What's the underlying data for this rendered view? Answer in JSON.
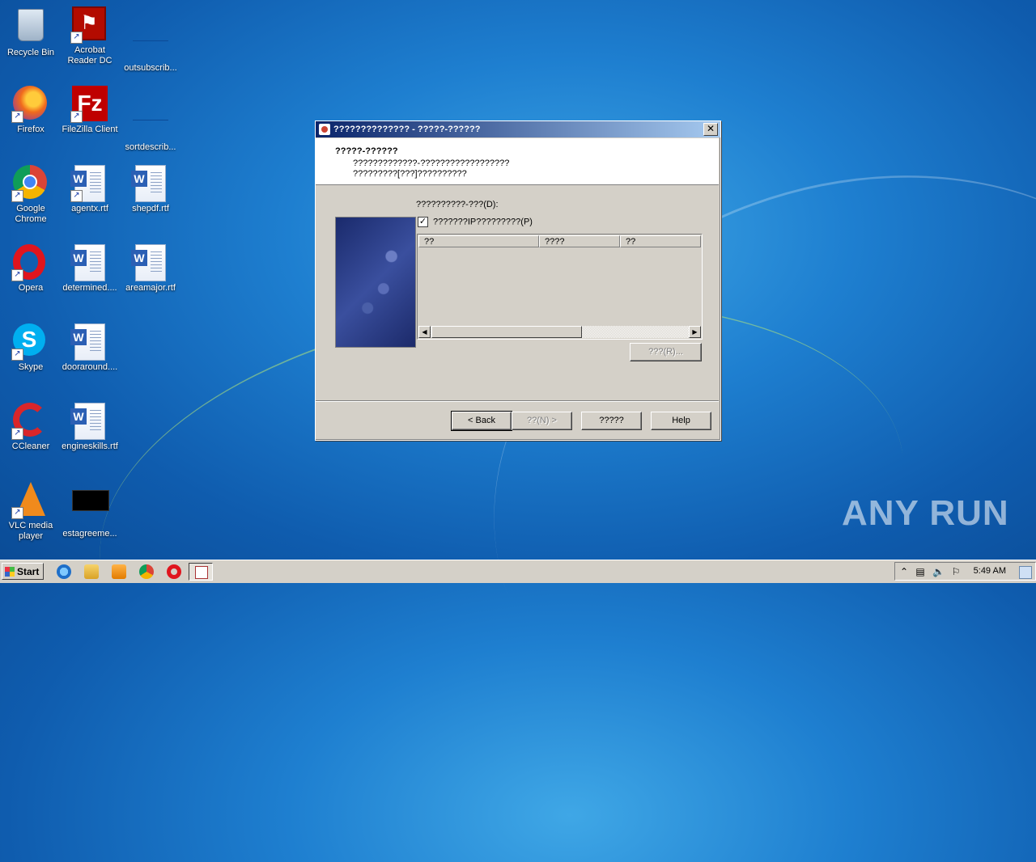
{
  "desktop": {
    "icons": [
      {
        "label": "Recycle Bin",
        "icon": "recycle-bin-icon"
      },
      {
        "label": "Acrobat Reader DC",
        "icon": "acrobat-icon"
      },
      {
        "label": "outsubscrib...",
        "icon": "file-icon"
      },
      {
        "label": "Firefox",
        "icon": "firefox-icon"
      },
      {
        "label": "FileZilla Client",
        "icon": "filezilla-icon"
      },
      {
        "label": "sortdescrib...",
        "icon": "file-icon"
      },
      {
        "label": "Google Chrome",
        "icon": "chrome-icon"
      },
      {
        "label": "agentx.rtf",
        "icon": "word-doc-icon"
      },
      {
        "label": "shepdf.rtf",
        "icon": "word-doc-icon"
      },
      {
        "label": "Opera",
        "icon": "opera-icon"
      },
      {
        "label": "determined....",
        "icon": "word-doc-icon"
      },
      {
        "label": "areamajor.rtf",
        "icon": "word-doc-icon"
      },
      {
        "label": "Skype",
        "icon": "skype-icon"
      },
      {
        "label": "dooraround....",
        "icon": "word-doc-icon"
      },
      {
        "label": "CCleaner",
        "icon": "ccleaner-icon"
      },
      {
        "label": "engineskills.rtf",
        "icon": "word-doc-icon"
      },
      {
        "label": "VLC media player",
        "icon": "vlc-icon"
      },
      {
        "label": "estagreeme...",
        "icon": "file-icon"
      }
    ]
  },
  "dialog": {
    "title": "?????????????? - ?????-??????",
    "header_title": "?????-??????",
    "header_line1": "?????????????-??????????????????",
    "header_line2": "?????????[???]??????????",
    "list_label": "??????????-???(D):",
    "checkbox_label": "???????IP?????????(P)",
    "checkbox_checked": true,
    "columns": [
      "??",
      "????",
      "??"
    ],
    "remove_button": "???(R)...",
    "buttons": {
      "back": "< Back",
      "next": "??(N) >",
      "cancel": "?????",
      "help": "Help"
    }
  },
  "taskbar": {
    "start_label": "Start",
    "pinned": [
      "ie-icon",
      "explorer-icon",
      "media-player-icon",
      "chrome-icon",
      "opera-icon",
      "active-wizard-icon"
    ],
    "clock": "5:49 AM"
  },
  "watermark": "ANY RUN",
  "colors": {
    "titlebar_start": "#0a246a",
    "titlebar_end": "#a6caf0",
    "dialog_face": "#d4d0c8"
  }
}
